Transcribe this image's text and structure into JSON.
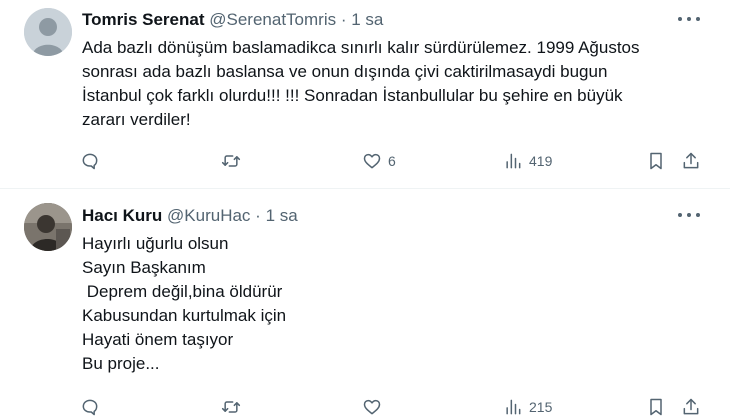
{
  "tweets": [
    {
      "name": "Tomris Serenat",
      "handle": "@SerenatTomris",
      "separator": "·",
      "time": "1 sa",
      "lines": [
        "Ada bazlı dönüşüm baslamadikca sınırlı kalır sürdürülemez. 1999 Ağustos",
        "sonrası ada bazlı baslansa ve onun dışında çivi caktirilmasaydi bugun",
        "İstanbul çok farklı olurdu!!! !!! Sonradan İstanbullular bu şehire en büyük",
        "zararı verdiler!"
      ],
      "likes": "6",
      "views": "419"
    },
    {
      "name": "Hacı Kuru",
      "handle": "@KuruHac",
      "separator": "·",
      "time": "1 sa",
      "lines": [
        "Hayırlı uğurlu olsun",
        "Sayın Başkanım",
        " Deprem değil,bina öldürür",
        "Kabusundan kurtulmak için",
        "Hayati önem taşıyor",
        "Bu proje..."
      ],
      "likes": "",
      "views": "215"
    }
  ],
  "icons": {
    "reply": "reply-icon",
    "retweet": "retweet-icon",
    "like": "heart-icon",
    "views": "views-icon",
    "bookmark": "bookmark-icon",
    "share": "share-icon",
    "more": "more-icon"
  },
  "colors": {
    "secondary_text": "#536471",
    "divider": "#eff3f4"
  }
}
